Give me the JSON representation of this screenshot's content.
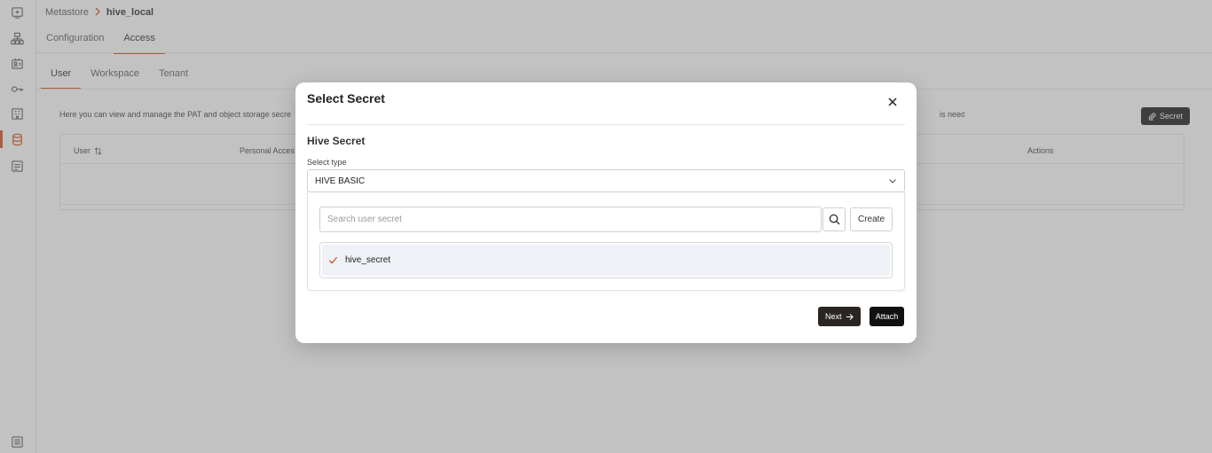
{
  "breadcrumb": {
    "root": "Metastore",
    "current": "hive_local"
  },
  "tabs_top": [
    {
      "label": "Configuration"
    },
    {
      "label": "Access"
    }
  ],
  "tabs_sub": [
    {
      "label": "User"
    },
    {
      "label": "Workspace"
    },
    {
      "label": "Tenant"
    }
  ],
  "description_left": "Here you can view and manage the PAT and object storage secre",
  "description_right": "is needed.",
  "secret_button_label": "Secret",
  "table": {
    "col_user": "User",
    "col_pat": "Personal Acces",
    "col_actions": "Actions"
  },
  "modal": {
    "title": "Select Secret",
    "section_title": "Hive Secret",
    "select_label": "Select type",
    "select_value": "HIVE BASIC",
    "search_placeholder": "Search user secret",
    "create_label": "Create",
    "items": [
      {
        "label": "hive_secret",
        "selected": true
      }
    ],
    "next_label": "Next",
    "attach_label": "Attach"
  },
  "colors": {
    "accent": "#d9480f",
    "primary_dark": "#111111"
  }
}
